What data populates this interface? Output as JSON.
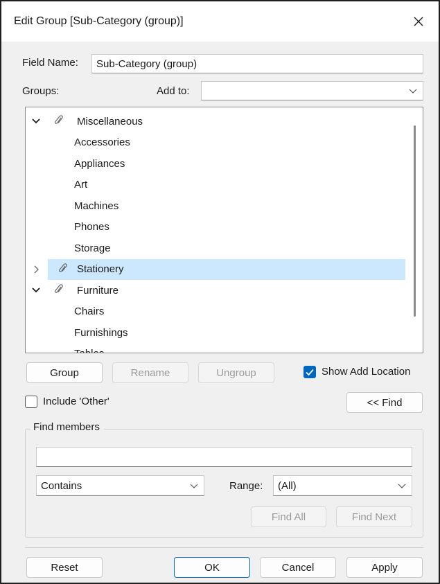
{
  "dialog": {
    "title": "Edit Group [Sub-Category (group)]"
  },
  "field_name": {
    "label": "Field Name:",
    "value": "Sub-Category (group)"
  },
  "groups_label": "Groups:",
  "add_to": {
    "label": "Add to:",
    "value": ""
  },
  "tree": {
    "rows": [
      {
        "label": "Miscellaneous",
        "kind": "group",
        "expanded": true
      },
      {
        "label": "Accessories",
        "kind": "member"
      },
      {
        "label": "Appliances",
        "kind": "member"
      },
      {
        "label": "Art",
        "kind": "member"
      },
      {
        "label": "Machines",
        "kind": "member"
      },
      {
        "label": "Phones",
        "kind": "member"
      },
      {
        "label": "Storage",
        "kind": "member"
      },
      {
        "label": "Stationery",
        "kind": "group",
        "expanded": false,
        "selected": true
      },
      {
        "label": "Furniture",
        "kind": "group",
        "expanded": true
      },
      {
        "label": "Chairs",
        "kind": "member"
      },
      {
        "label": "Furnishings",
        "kind": "member"
      },
      {
        "label": "Tables",
        "kind": "member"
      }
    ]
  },
  "buttons": {
    "group": "Group",
    "rename": "Rename",
    "ungroup": "Ungroup",
    "find_toggle": "<< Find",
    "reset": "Reset",
    "ok": "OK",
    "cancel": "Cancel",
    "apply": "Apply",
    "find_all": "Find All",
    "find_next": "Find Next"
  },
  "show_add_location": {
    "label": "Show Add Location",
    "checked": true
  },
  "include_other": {
    "label": "Include 'Other'",
    "checked": false
  },
  "find_members": {
    "title": "Find members",
    "search_value": "",
    "match_mode": "Contains",
    "range_label": "Range:",
    "range_value": "(All)"
  },
  "colors": {
    "accent": "#0067c0",
    "selection": "#cce8ff",
    "dialog_bg": "#f0f0f0"
  }
}
